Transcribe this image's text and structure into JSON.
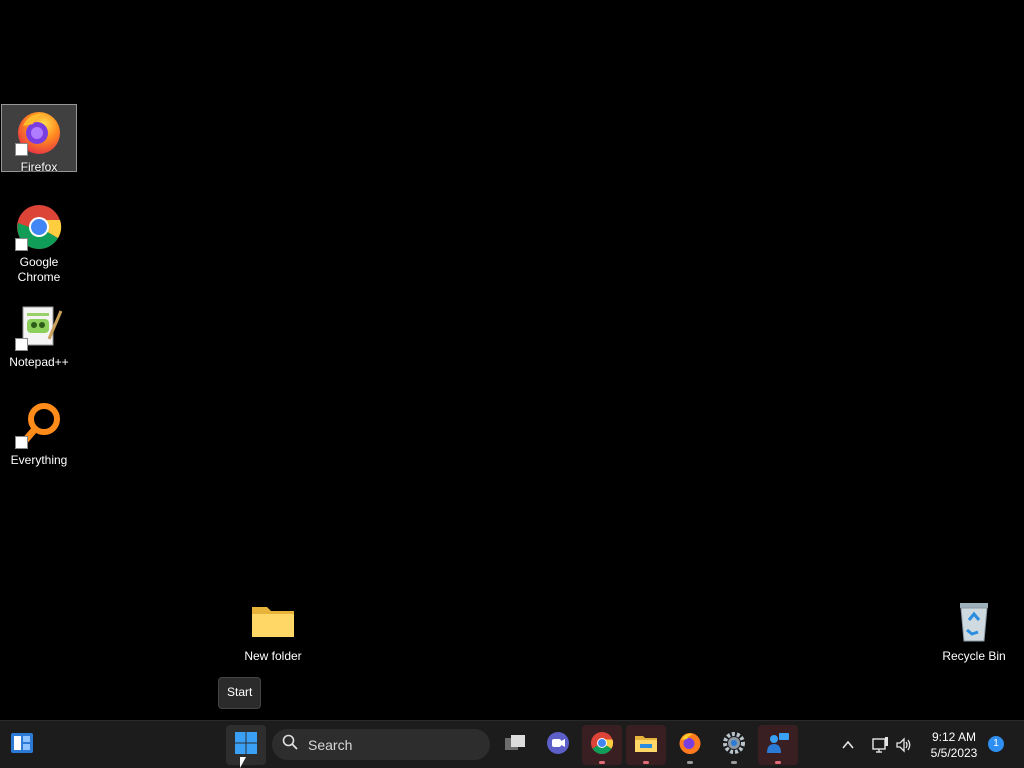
{
  "desktop": {
    "icons": [
      {
        "label": "Firefox",
        "icon": "firefox-icon"
      },
      {
        "label": "Google Chrome",
        "icon": "chrome-icon"
      },
      {
        "label": "Notepad++",
        "icon": "notepadpp-icon"
      },
      {
        "label": "Everything",
        "icon": "everything-icon"
      },
      {
        "label": "New folder",
        "icon": "folder-icon"
      },
      {
        "label": "Recycle Bin",
        "icon": "recycle-bin-icon"
      }
    ],
    "selected_icon": "Firefox"
  },
  "tooltip": {
    "text": "Start"
  },
  "taskbar": {
    "widgets_icon": "widgets-icon",
    "start_icon": "windows-start-icon",
    "search": {
      "placeholder": "Search"
    },
    "pinned": [
      {
        "name": "Task View",
        "icon": "task-view-icon"
      },
      {
        "name": "Chat",
        "icon": "chat-icon"
      },
      {
        "name": "Google Chrome",
        "icon": "chrome-icon"
      },
      {
        "name": "File Explorer",
        "icon": "file-explorer-icon"
      },
      {
        "name": "Firefox",
        "icon": "firefox-icon"
      },
      {
        "name": "Settings",
        "icon": "settings-gear-icon"
      },
      {
        "name": "Quick Assist",
        "icon": "quick-assist-icon"
      }
    ]
  },
  "tray": {
    "chevron_icon": "chevron-up-icon",
    "network_icon": "network-icon",
    "volume_icon": "volume-icon",
    "time": "9:12 AM",
    "date": "5/5/2023",
    "notifications": "1"
  },
  "colors": {
    "desktop_bg": "#000000",
    "taskbar_bg": "#1c1c1c",
    "accent": "#2f8ff0"
  }
}
